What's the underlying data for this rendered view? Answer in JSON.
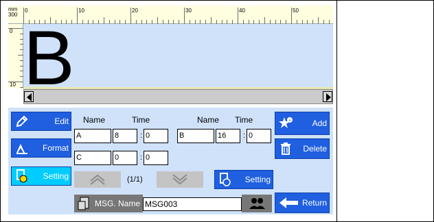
{
  "ruler": {
    "unit_label": "mm",
    "unit_sub_label": "300",
    "top_numbers": [
      "0",
      "10",
      "20",
      "30",
      "40",
      "50"
    ],
    "left_numbers": [
      "0",
      "10"
    ]
  },
  "canvas": {
    "preview_text": "B",
    "background": "#cfe2fa"
  },
  "left_buttons": {
    "edit": "Edit",
    "format": "Format",
    "setting": "Setting"
  },
  "right_buttons": {
    "add": "Add",
    "delete": "Delete",
    "return": "Return"
  },
  "table": {
    "col1_name": "Name",
    "col1_time": "Time",
    "col2_name": "Name",
    "col2_time": "Time",
    "rows": [
      {
        "name": "A",
        "time": "8",
        "sub": "0"
      },
      {
        "name": "C",
        "time": "0",
        "sub": "0"
      }
    ],
    "rows_right": [
      {
        "name": "B",
        "time": "16",
        "sub": "0"
      }
    ],
    "colon": ":"
  },
  "paging": {
    "indicator": "(1/1)"
  },
  "setting_button": "Setting",
  "msg": {
    "label": "MSG. Name",
    "value": "MSG003"
  },
  "colors": {
    "button_blue": "#1f5fe0",
    "active_cyan": "#00ccff",
    "panel_bg": "#cfe2fa"
  }
}
